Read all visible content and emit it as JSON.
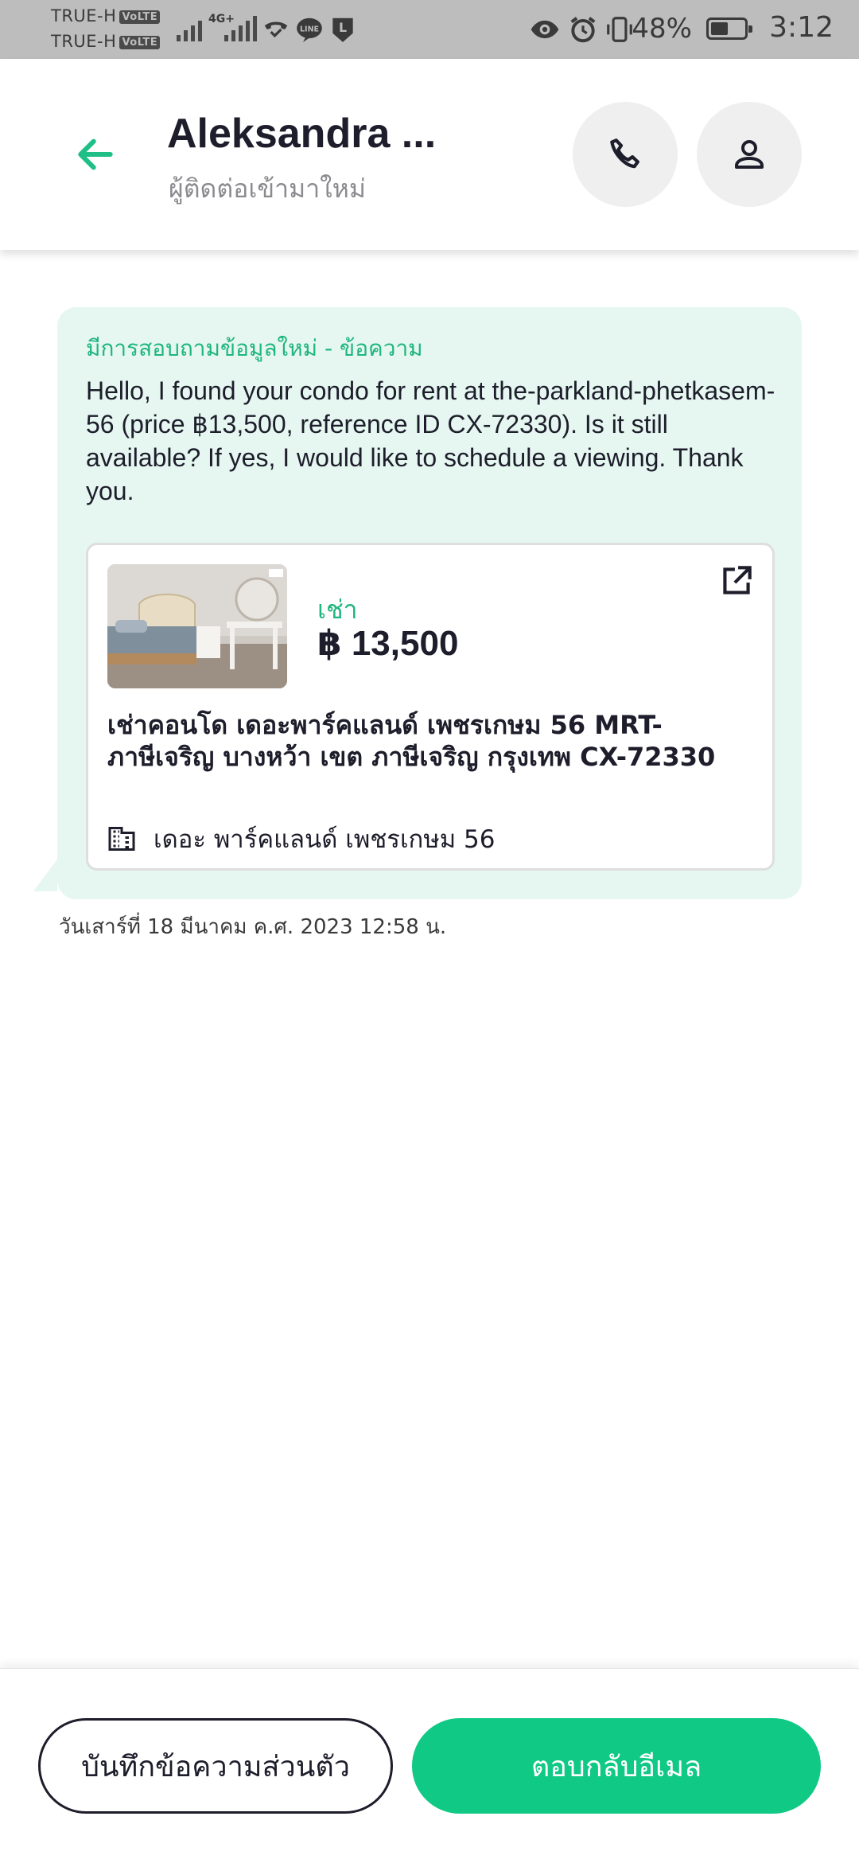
{
  "status_bar": {
    "carrier_1": "TRUE-H",
    "carrier_2": "TRUE-H",
    "volte": "VoLTE",
    "network": "4G+",
    "battery": "48%",
    "battery_level": 0.48,
    "time": "3:12",
    "icons": [
      "signal-icon",
      "line-app-icon",
      "l-app-icon",
      "eye-icon",
      "alarm-icon",
      "vibrate-icon",
      "battery-icon"
    ]
  },
  "header": {
    "contact_name": "Aleksandra  ...",
    "contact_status": "ผู้ติดต่อเข้ามาใหม่",
    "icons": [
      "back-arrow-icon",
      "phone-icon",
      "person-icon"
    ]
  },
  "message": {
    "label": "มีการสอบถามข้อมูลใหม่ - ข้อความ",
    "body": "Hello, I found your condo for rent at the-parkland-phetkasem-56 (price ฿13,500, reference ID CX-72330). Is it still available? If yes, I would like to schedule a viewing. Thank you.",
    "timestamp": "วันเสาร์ที่ 18 มีนาคม ค.ศ. 2023 12:58 น."
  },
  "listing": {
    "deal_type": "เช่า",
    "price": "฿ 13,500",
    "title": "เช่าคอนโด  เดอะพาร์คแลนด์ เพชรเกษม 56 MRT-ภาษีเจริญ บางหว้า เขต ภาษีเจริญ กรุงเทพ CX-72330",
    "project": "เดอะ พาร์คแลนด์ เพชรเกษม 56",
    "icons": [
      "external-link-icon",
      "building-icon"
    ]
  },
  "actions": {
    "note_label": "บันทึกข้อความส่วนตัว",
    "reply_label": "ตอบกลับอีเมล"
  },
  "colors": {
    "accent": "#0fc985",
    "accent_text": "#1fb57f",
    "bubble": "#e5f7f0",
    "status_bar": "#bdbdbd"
  }
}
